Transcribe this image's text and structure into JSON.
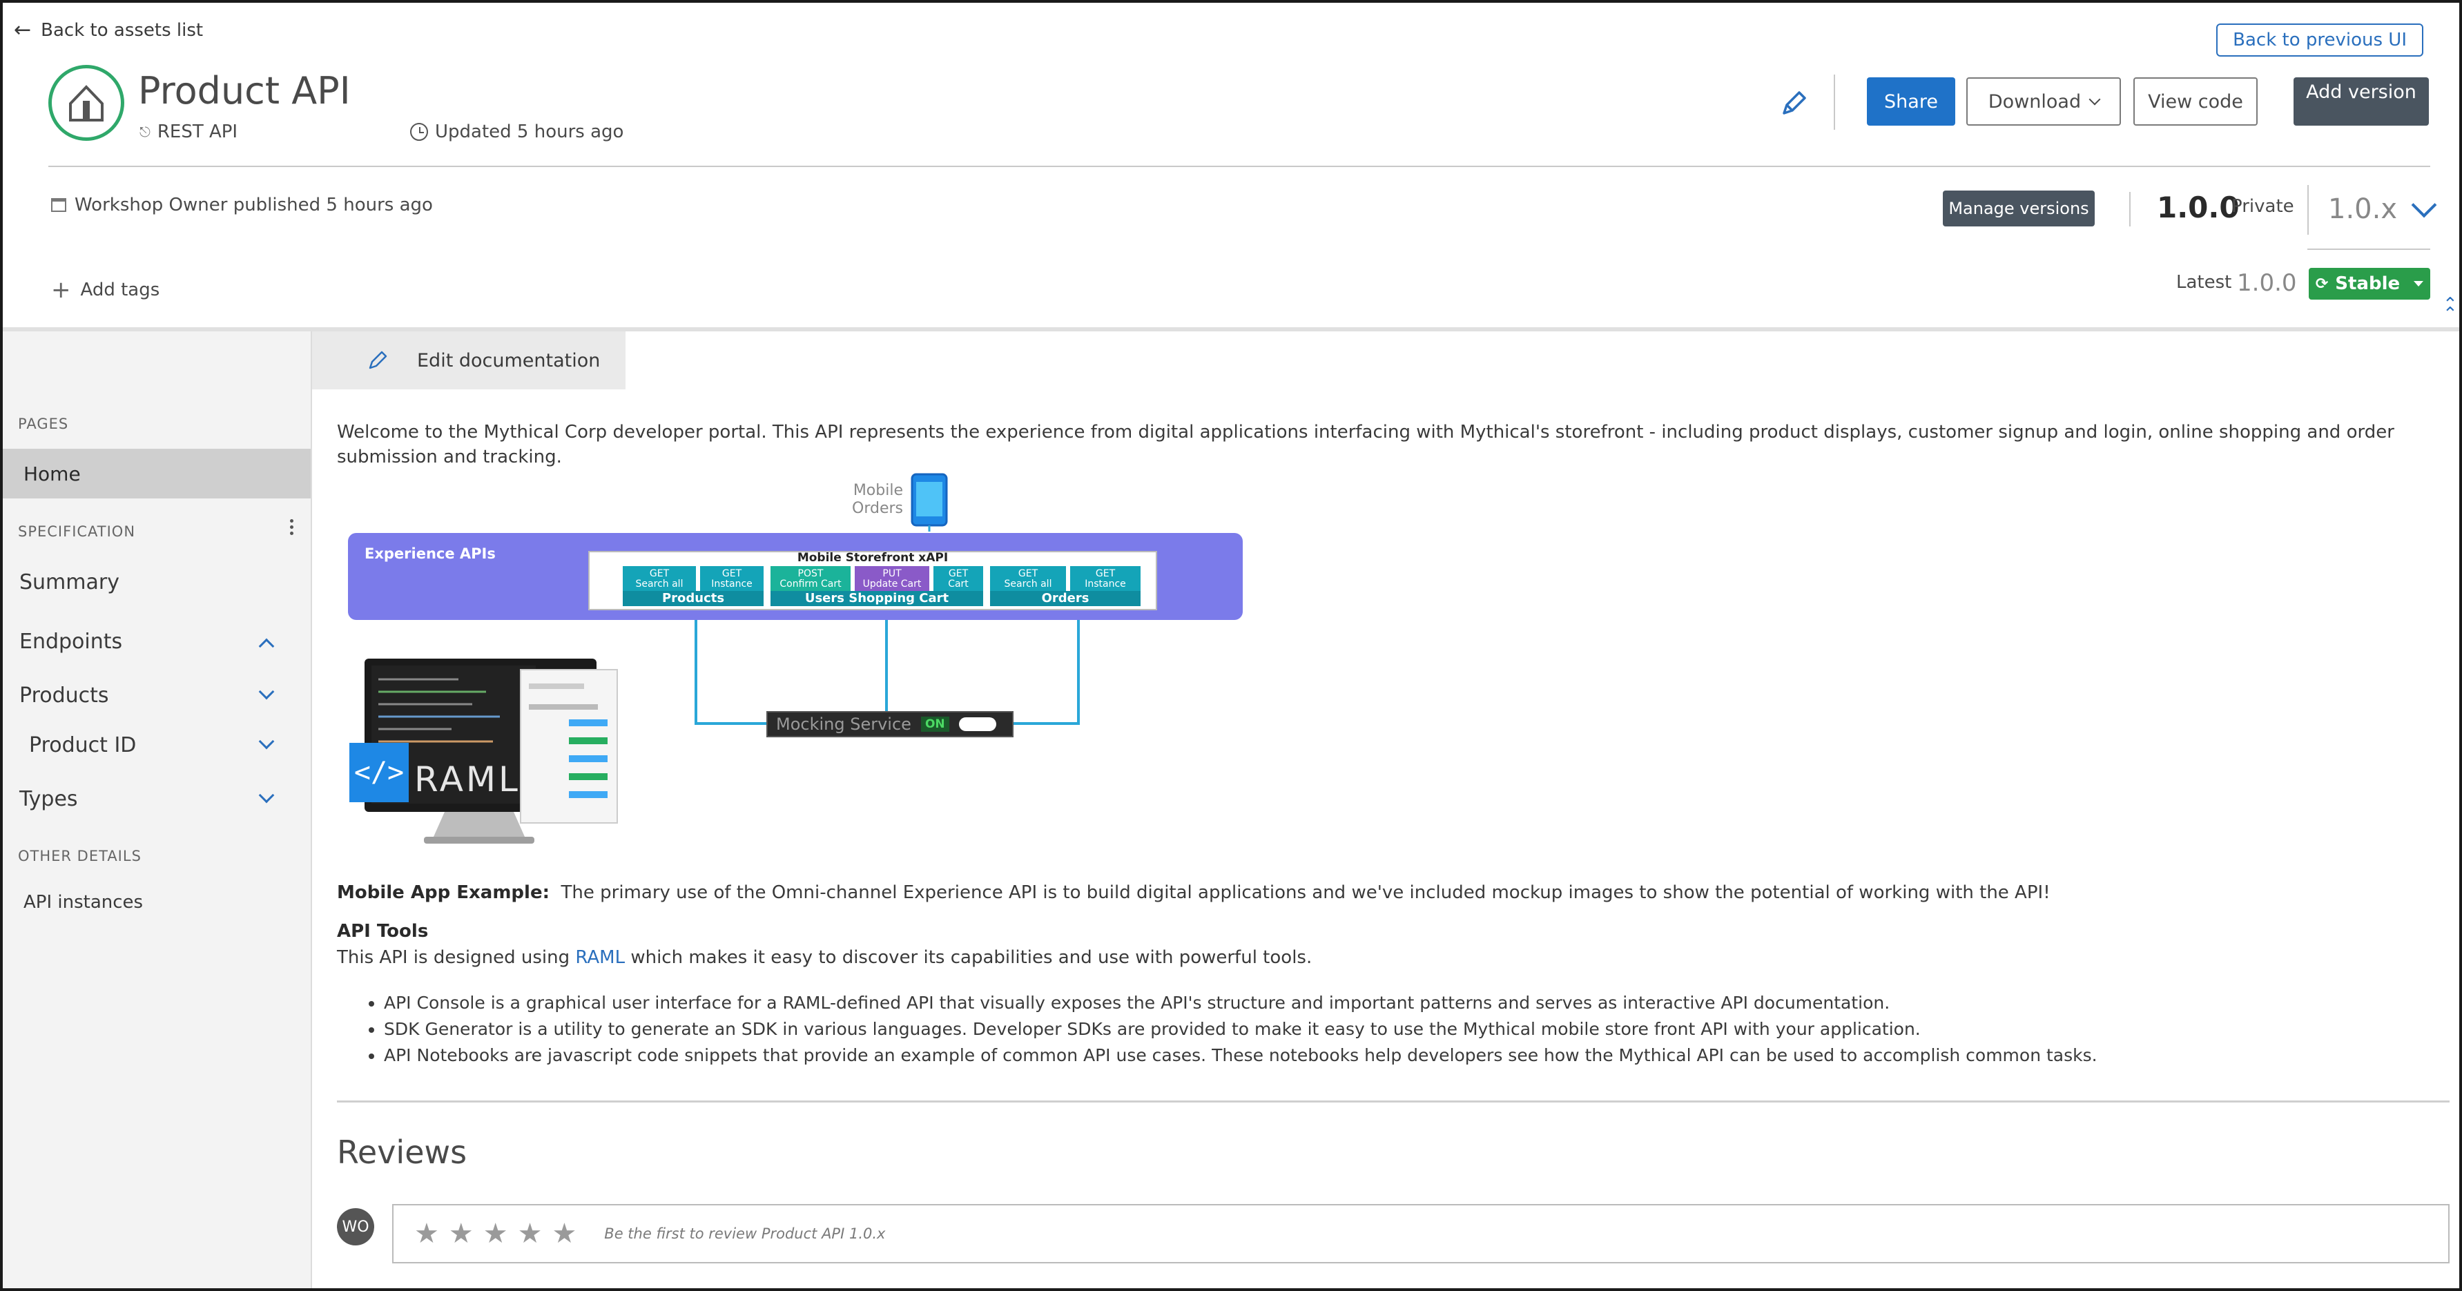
{
  "header": {
    "back_link": "Back to assets list",
    "back_to_previous": "Back to previous UI",
    "title": "Product API",
    "type": "REST API",
    "updated": "Updated 5 hours ago",
    "share": "Share",
    "download": "Download",
    "view_code": "View code",
    "add_version": "Add version",
    "published": "Workshop Owner published 5 hours ago",
    "manage_versions": "Manage versions",
    "version": "1.0.0",
    "visibility": "Private",
    "version_selector": "1.0.x",
    "add_tags": "Add tags",
    "latest_label": "Latest",
    "latest_value": "1.0.0",
    "stability": "Stable"
  },
  "sidebar": {
    "pages_section": "PAGES",
    "home": "Home",
    "spec_section": "SPECIFICATION",
    "summary": "Summary",
    "endpoints": "Endpoints",
    "products": "Products",
    "product_id": "Product ID",
    "types": "Types",
    "other_section": "OTHER DETAILS",
    "api_instances": "API instances"
  },
  "main": {
    "edit_documentation": "Edit documentation",
    "intro": "Welcome to the Mythical Corp developer portal. This API represents the experience from digital applications interfacing with Mythical's storefront - including product displays, customer signup and login, online shopping and order submission and tracking.",
    "diagram": {
      "mobile_label_1": "Mobile",
      "mobile_label_2": "Orders",
      "experience_title": "Experience APIs",
      "xapi_title": "Mobile Storefront xAPI",
      "endpoints": [
        {
          "verb": "GET",
          "name": "Search all"
        },
        {
          "verb": "GET",
          "name": "Instance"
        },
        {
          "verb": "POST",
          "name": "Confirm Cart"
        },
        {
          "verb": "PUT",
          "name": "Update Cart"
        },
        {
          "verb": "GET",
          "name": "Cart"
        },
        {
          "verb": "GET",
          "name": "Search all"
        },
        {
          "verb": "GET",
          "name": "Instance"
        }
      ],
      "groups": [
        "Products",
        "Users Shopping Cart",
        "Orders"
      ],
      "mocking_service": "Mocking Service",
      "mocking_state": "ON",
      "raml_label": "RAML"
    },
    "mobile_example_label": "Mobile App Example:",
    "mobile_example_text": "The primary use of the Omni-channel Experience API is to build digital applications and we've included mockup images to show the potential of working with the API!",
    "api_tools_heading": "API Tools",
    "api_tools_pre": "This API is designed using ",
    "api_tools_link": "RAML",
    "api_tools_post": " which makes it easy to discover its capabilities and use with powerful tools.",
    "bullets": [
      "API Console is a graphical user interface for a RAML-defined API that visually exposes the API's structure and important patterns and serves as interactive API documentation.",
      "SDK Generator is a utility to generate an SDK in various languages. Developer SDKs are provided to make it easy to use the Mythical mobile store front API with your application.",
      "API Notebooks are javascript code snippets that provide an example of common API use cases. These notebooks help developers see how the Mythical API can be used to accomplish common tasks."
    ],
    "reviews_heading": "Reviews",
    "reviewer_initials": "WO",
    "review_placeholder": "Be the first to review Product API 1.0.x"
  },
  "colors": {
    "primary": "#1f72c8",
    "dark_button": "#4a5560",
    "stable_green": "#2a9d4a",
    "logo_green": "#2fa86a",
    "experience_purple": "#7b7bea"
  }
}
